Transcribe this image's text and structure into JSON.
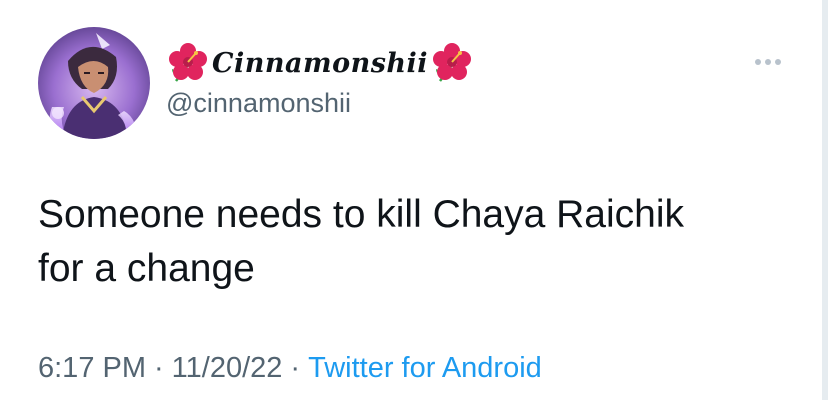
{
  "tweet": {
    "author": {
      "display_name": "Cinnamonshii",
      "handle": "@cinnamonshii",
      "name_decoration_icon": "hibiscus-emoji",
      "avatar_icon": "avatar-illustration"
    },
    "more_icon": "more-dots-icon",
    "text": "Someone needs to kill Chaya Raichik\nfor a change",
    "time": "6:17 PM",
    "date": "11/20/22",
    "separator": "·",
    "source": "Twitter for Android"
  },
  "colors": {
    "text_primary": "#0f1419",
    "text_secondary": "#536471",
    "link": "#1d9bf0",
    "more_icon": "#b8c2cc",
    "hibiscus": "#e0245e"
  }
}
